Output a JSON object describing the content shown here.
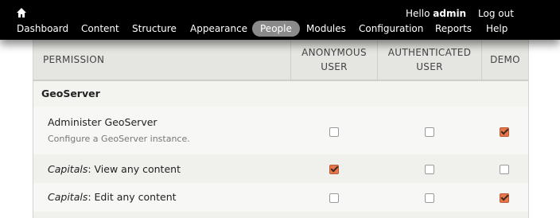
{
  "toolbar": {
    "greeting": "Hello",
    "username": "admin",
    "logout_label": "Log out",
    "menu": [
      {
        "label": "Dashboard"
      },
      {
        "label": "Content"
      },
      {
        "label": "Structure"
      },
      {
        "label": "Appearance"
      },
      {
        "label": "People",
        "active": true
      },
      {
        "label": "Modules"
      },
      {
        "label": "Configuration"
      },
      {
        "label": "Reports"
      },
      {
        "label": "Help"
      }
    ]
  },
  "table": {
    "headers": {
      "permission": "PERMISSION",
      "anonymous": "ANONYMOUS\nUSER",
      "authenticated": "AUTHENTICATED\nUSER",
      "demo": "DEMO"
    },
    "module": "GeoServer",
    "rows": [
      {
        "title": "Administer GeoServer",
        "title_prefix": "",
        "description": "Configure a GeoServer instance.",
        "anonymous": false,
        "authenticated": false,
        "demo": true
      },
      {
        "title": ": View any content",
        "title_prefix": "Capitals",
        "description": "",
        "anonymous": true,
        "authenticated": false,
        "demo": false
      },
      {
        "title": ": Edit any content",
        "title_prefix": "Capitals",
        "description": "",
        "anonymous": false,
        "authenticated": false,
        "demo": true
      }
    ]
  },
  "colors": {
    "checkbox_checked": "#e9764a",
    "toolbar_bg": "#000000",
    "active_tab": "#8a8a8a"
  }
}
